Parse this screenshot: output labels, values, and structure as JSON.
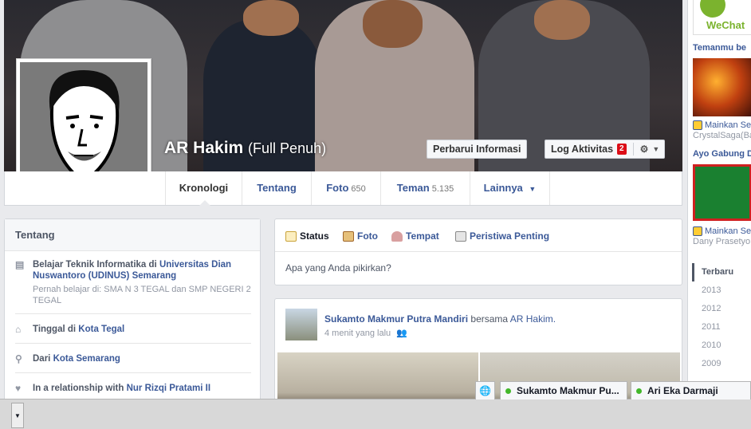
{
  "profile": {
    "name": "AR Hakim",
    "alternate_name": "(Full Penuh)",
    "update_info_label": "Perbarui Informasi",
    "activity_log_label": "Log Aktivitas",
    "activity_log_count": "2"
  },
  "nav": {
    "tabs": [
      {
        "label": "Kronologi",
        "count": ""
      },
      {
        "label": "Tentang",
        "count": ""
      },
      {
        "label": "Foto",
        "count": "650"
      },
      {
        "label": "Teman",
        "count": "5.135"
      },
      {
        "label": "Lainnya",
        "count": ""
      }
    ]
  },
  "about": {
    "title": "Tentang",
    "education_prefix": "Belajar Teknik Informatika di",
    "education_school": "Universitas Dian Nuswantoro (UDINUS) Semarang",
    "education_past": "Pernah belajar di: SMA N 3 TEGAL dan SMP NEGERI 2 TEGAL",
    "lives_prefix": "Tinggal di",
    "lives_city": "Kota Tegal",
    "from_prefix": "Dari",
    "from_city": "Kota Semarang",
    "relationship_prefix": "In a relationship with",
    "relationship_name": "Nur Rizqi Pratami II"
  },
  "composer": {
    "tabs": [
      "Status",
      "Foto",
      "Tempat",
      "Peristiwa Penting"
    ],
    "placeholder": "Apa yang Anda pikirkan?"
  },
  "story": {
    "author": "Sukamto Makmur Putra Mandiri",
    "with_word": "bersama",
    "tagged": "AR Hakim.",
    "time": "4 menit yang lalu"
  },
  "right_column": {
    "wechat_label": "WeChat",
    "friends_heading": "Temanmu be",
    "game1_play": "Mainkan Se",
    "game1_sub": "CrystalSaga(Ba",
    "join_heading": "Ayo Gabung D",
    "game2_play": "Mainkan Se",
    "game2_sub": "Dany Prasetyo"
  },
  "years": [
    "Terbaru",
    "2013",
    "2012",
    "2011",
    "2010",
    "2009"
  ],
  "chat": {
    "tab1": "Sukamto Makmur Pu...",
    "tab2": "Ari Eka Darmaji"
  },
  "colors": {
    "brand": "#3b5998",
    "badge": "#dc0d17",
    "online": "#42b72a"
  }
}
